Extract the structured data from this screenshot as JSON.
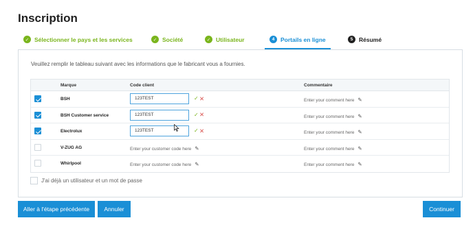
{
  "page": {
    "title": "Inscription"
  },
  "steps": [
    {
      "num": "✓",
      "label": "Sélectionner le pays et les services",
      "state": "done"
    },
    {
      "num": "✓",
      "label": "Société",
      "state": "done"
    },
    {
      "num": "✓",
      "label": "Utilisateur",
      "state": "done"
    },
    {
      "num": "4",
      "label": "Portails en ligne",
      "state": "active"
    },
    {
      "num": "5",
      "label": "Résumé",
      "state": "pending"
    }
  ],
  "panel": {
    "intro": "Veuillez remplir le tableau suivant avec les informations que le fabricant vous a fournies.",
    "headers": {
      "brand": "Marque",
      "code": "Code client",
      "comment": "Commentaire"
    },
    "rows": [
      {
        "checked": true,
        "brand": "BSH",
        "code": "123TEST",
        "code_placeholder": "",
        "comment_placeholder": "Enter your comment here"
      },
      {
        "checked": true,
        "brand": "BSH Customer service",
        "code": "123TEST",
        "code_placeholder": "",
        "comment_placeholder": "Enter your comment here"
      },
      {
        "checked": true,
        "brand": "Electrolux",
        "code": "123TEST",
        "code_placeholder": "",
        "comment_placeholder": "Enter your comment here"
      },
      {
        "checked": false,
        "brand": "V-ZUG AG",
        "code": "",
        "code_placeholder": "Enter your customer code here",
        "comment_placeholder": "Enter your comment here"
      },
      {
        "checked": false,
        "brand": "Whirlpool",
        "code": "",
        "code_placeholder": "Enter your customer code here",
        "comment_placeholder": "Enter your comment here"
      }
    ],
    "already_label": "J'ai déjà un utilisateur et un mot de passe"
  },
  "buttons": {
    "back": "Aller à l'étape précédente",
    "cancel": "Annuler",
    "continue": "Continuer"
  },
  "icons": {
    "confirm": "✓",
    "reject": "✕",
    "edit": "✎"
  },
  "colors": {
    "accent": "#1a8fd6",
    "done": "#7ab51d",
    "reject": "#d9534f"
  }
}
